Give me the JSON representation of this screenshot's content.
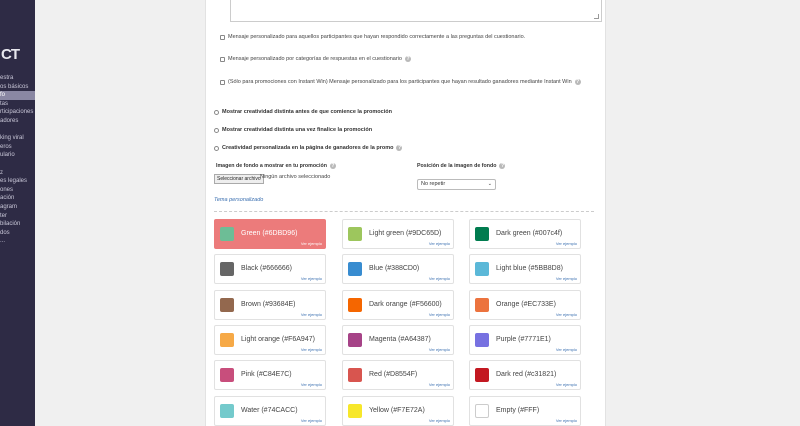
{
  "sidebar": {
    "logo": "CT",
    "items": [
      {
        "label": "estra",
        "active": false
      },
      {
        "label": "os básicos",
        "active": false
      },
      {
        "label": "fo",
        "active": true
      },
      {
        "label": "tas",
        "active": false
      },
      {
        "label": "rticipaciones",
        "active": false
      },
      {
        "label": "adores",
        "active": false
      },
      {
        "label": "",
        "active": false
      },
      {
        "label": "king viral",
        "active": false
      },
      {
        "label": "eros",
        "active": false
      },
      {
        "label": "ulario",
        "active": false
      },
      {
        "label": "",
        "active": false
      },
      {
        "label": "z",
        "active": false
      },
      {
        "label": "es legales",
        "active": false
      },
      {
        "label": "ones",
        "active": false
      },
      {
        "label": "ación",
        "active": false
      },
      {
        "label": "agram",
        "active": false
      },
      {
        "label": "ter",
        "active": false
      },
      {
        "label": "bilación",
        "active": false
      },
      {
        "label": "dos",
        "active": false
      },
      {
        "label": "...",
        "active": false
      }
    ]
  },
  "messages": {
    "opt1": "Mensaje personalizado para aquellos participantes que hayan respondido correctamente a las preguntas del cuestionario.",
    "opt2": "Mensaje personalizado por categorías de respuestas en el cuestionario",
    "opt3": "(Sólo para promociones con Instant Win) Mensaje personalizado para los participantes que hayan resultado ganadores mediante Instant Win"
  },
  "creativity": {
    "opt1": "Mostrar creatividad distinta antes de que comience la promoción",
    "opt2": "Mostrar creatividad distinta una vez finalice la promoción",
    "opt3": "Creatividad personalizada en la página de ganadores de la promo"
  },
  "background": {
    "image_label": "Imagen de fondo a mostrar en tu promoción",
    "file_button": "Seleccionar archivo",
    "file_status": "Ningún archivo seleccionado",
    "position_label": "Posición de la imagen de fondo",
    "position_value": "No repetir"
  },
  "theme": {
    "title": "Tema personalizado",
    "example_link": "Ver ejemplo",
    "swatches": [
      {
        "name": "Green (#6DBD96)",
        "color": "#6DBD96",
        "selected": true
      },
      {
        "name": "Light green (#9DC65D)",
        "color": "#9DC65D",
        "selected": false
      },
      {
        "name": "Dark green (#007c4f)",
        "color": "#007c4f",
        "selected": false
      },
      {
        "name": "Black (#666666)",
        "color": "#666666",
        "selected": false
      },
      {
        "name": "Blue (#388CD0)",
        "color": "#388CD0",
        "selected": false
      },
      {
        "name": "Light blue (#5BB8D8)",
        "color": "#5BB8D8",
        "selected": false
      },
      {
        "name": "Brown (#93684E)",
        "color": "#93684E",
        "selected": false
      },
      {
        "name": "Dark orange (#F56600)",
        "color": "#F56600",
        "selected": false
      },
      {
        "name": "Orange (#EC733E)",
        "color": "#EC733E",
        "selected": false
      },
      {
        "name": "Light orange (#F6A947)",
        "color": "#F6A947",
        "selected": false
      },
      {
        "name": "Magenta (#A64387)",
        "color": "#A64387",
        "selected": false
      },
      {
        "name": "Purple (#7771E1)",
        "color": "#7771E1",
        "selected": false
      },
      {
        "name": "Pink (#C84E7C)",
        "color": "#C84E7C",
        "selected": false
      },
      {
        "name": "Red (#D8554F)",
        "color": "#D8554F",
        "selected": false
      },
      {
        "name": "Dark red (#c31821)",
        "color": "#c31821",
        "selected": false
      },
      {
        "name": "Water (#74CACC)",
        "color": "#74CACC",
        "selected": false
      },
      {
        "name": "Yellow (#F7E72A)",
        "color": "#F7E72A",
        "selected": false
      },
      {
        "name": "Empty (#FFF)",
        "color": "#FFFFFF",
        "selected": false
      }
    ]
  }
}
